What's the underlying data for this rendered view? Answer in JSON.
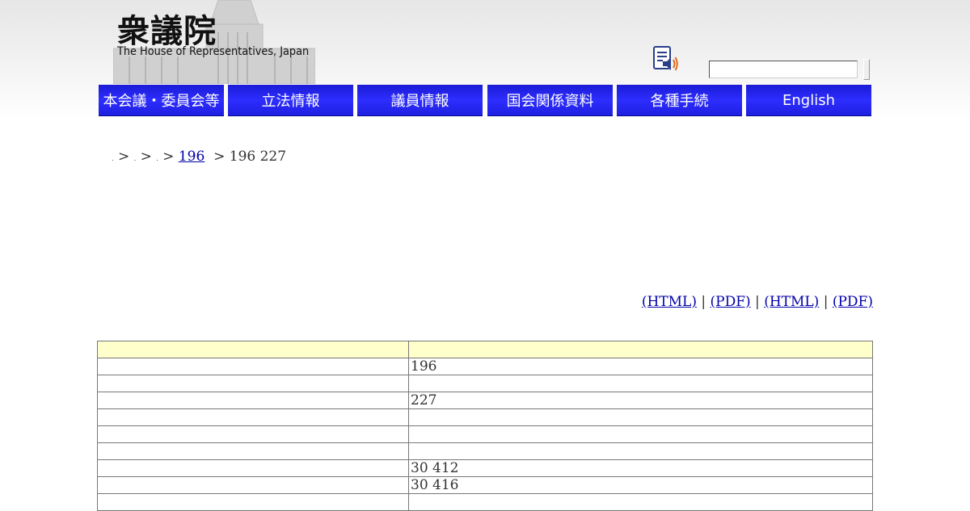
{
  "header": {
    "logo_kanji": "衆議院",
    "logo_english": "The House of Representatives, Japan",
    "search": {
      "value": "",
      "placeholder": ""
    }
  },
  "nav": [
    {
      "label": "本会議・委員会等"
    },
    {
      "label": "立法情報"
    },
    {
      "label": "議員情報"
    },
    {
      "label": "国会関係資料"
    },
    {
      "label": "各種手続"
    },
    {
      "label": "English"
    }
  ],
  "breadcrumb": {
    "sep": ">",
    "session_link": "196",
    "current": "196 227"
  },
  "doc_links": {
    "link1": "(HTML)",
    "link2": "(PDF)",
    "link3": "(HTML)",
    "link4": "(PDF)",
    "divider": "|"
  },
  "table": {
    "header": [
      "",
      ""
    ],
    "rows": [
      [
        "",
        "196"
      ],
      [
        "",
        ""
      ],
      [
        "",
        "227"
      ],
      [
        "",
        ""
      ],
      [
        "",
        ""
      ],
      [
        "",
        ""
      ],
      [
        "",
        "30 412"
      ],
      [
        "",
        "30 416"
      ],
      [
        "",
        ""
      ]
    ]
  },
  "colors": {
    "nav_blue": "#2323f0",
    "table_header": "#ffffcc",
    "link": "#0000aa"
  }
}
